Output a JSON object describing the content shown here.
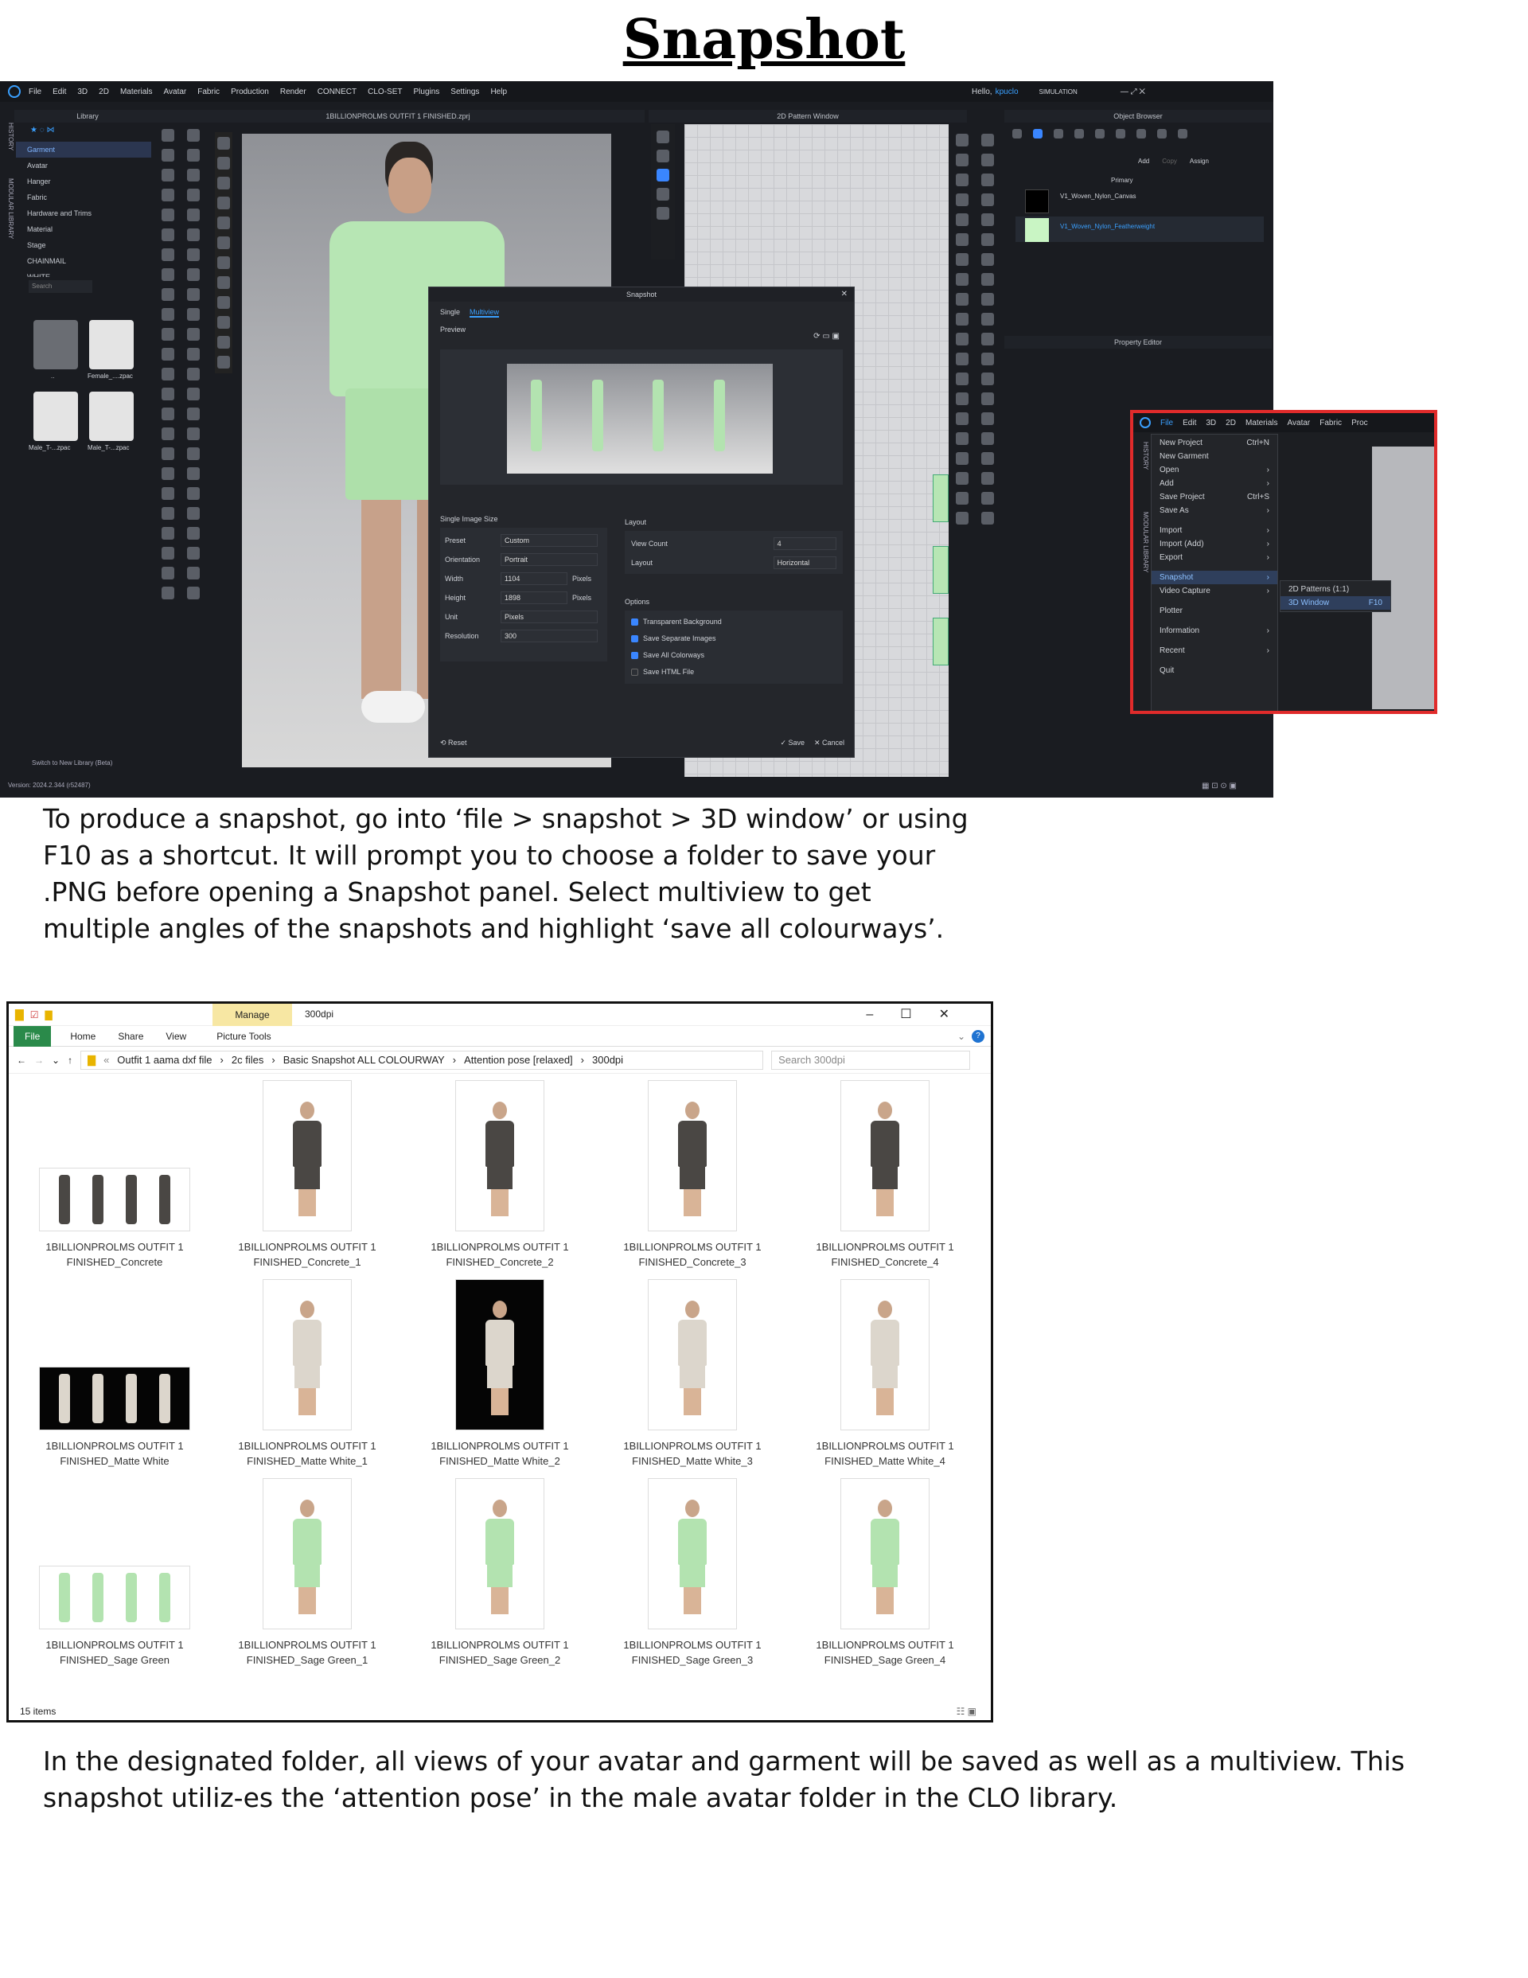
{
  "title": "Snapshot",
  "clo": {
    "menu": [
      "File",
      "Edit",
      "3D",
      "2D",
      "Materials",
      "Avatar",
      "Fabric",
      "Production",
      "Render",
      "CONNECT",
      "CLO-SET",
      "Plugins",
      "Settings",
      "Help"
    ],
    "greeting": "Hello,",
    "user": "kpuclo",
    "mode": "SIMULATION",
    "library_title": "Library",
    "window_title": "1BILLIONPROLMS OUTFIT 1 FINISHED.zprj",
    "pattern_title": "2D Pattern Window",
    "object_browser": "Object Browser",
    "property_editor": "Property Editor",
    "side_tabs": [
      "HISTORY",
      "MODULAR LIBRARY"
    ],
    "library_items": [
      "Garment",
      "Avatar",
      "Hanger",
      "Fabric",
      "Hardware and Trims",
      "Material",
      "Stage",
      "CHAINMAIL",
      "WHITE"
    ],
    "search": "Search",
    "thumbs": [
      "..",
      "Female_....zpac",
      "Male_T-...zpac",
      "Male_T-...zpac"
    ],
    "switch_lib": "Switch to New Library (Beta)",
    "version": "Version: 2024.2.344 (r52487)",
    "ob_actions": [
      "Add",
      "Copy",
      "Assign"
    ],
    "ob_primary": "Primary",
    "fabrics": [
      "V1_Woven_Nylon_Canvas",
      "V1_Woven_Nylon_Featherweight"
    ],
    "colors": {
      "canvas": "#000000",
      "featherweight": "#c9f5c4",
      "accent": "#3a86ff",
      "highlight": "#e02b2b",
      "garment": "#b7e6b4"
    }
  },
  "dialog": {
    "title": "Snapshot",
    "tabs": [
      "Single",
      "Multiview"
    ],
    "preview": "Preview",
    "image_size": "Single Image Size",
    "fields": [
      [
        "Preset",
        "Custom"
      ],
      [
        "Orientation",
        "Portrait"
      ],
      [
        "Width",
        "1104"
      ],
      [
        "Height",
        "1898"
      ],
      [
        "Unit",
        "Pixels"
      ],
      [
        "Resolution",
        "300"
      ]
    ],
    "px": "Pixels",
    "layout": "Layout",
    "layout_fields": [
      [
        "View Count",
        "4"
      ],
      [
        "Layout",
        "Horizontal"
      ]
    ],
    "options": "Options",
    "option_items": [
      "Transparent Background",
      "Save Separate Images",
      "Save All Colorways",
      "Save HTML File"
    ],
    "option_checked": [
      true,
      true,
      true,
      false
    ],
    "reset": "Reset",
    "save": "Save",
    "cancel": "Cancel"
  },
  "mini": {
    "menu": [
      "File",
      "Edit",
      "3D",
      "2D",
      "Materials",
      "Avatar",
      "Fabric",
      "Proc"
    ],
    "items": [
      [
        "New Project",
        "Ctrl+N"
      ],
      [
        "New Garment",
        ""
      ],
      [
        "Open",
        "›"
      ],
      [
        "Add",
        "›"
      ],
      [
        "Save Project",
        "Ctrl+S"
      ],
      [
        "Save As",
        "›"
      ],
      [
        "Import",
        "›"
      ],
      [
        "Import (Add)",
        "›"
      ],
      [
        "Export",
        "›"
      ],
      [
        "Snapshot",
        "›"
      ],
      [
        "Video Capture",
        "›"
      ],
      [
        "Plotter",
        ""
      ],
      [
        "Information",
        "›"
      ],
      [
        "Recent",
        "›"
      ],
      [
        "Quit",
        ""
      ]
    ],
    "sub": [
      [
        "2D Patterns (1:1)",
        ""
      ],
      [
        "3D Window",
        "F10"
      ]
    ],
    "side": [
      "HISTORY",
      "MODULAR LIBRARY"
    ]
  },
  "para1": "To produce a snapshot, go into ‘file > snapshot > 3D window’ or using F10 as a shortcut. It will prompt you to choose a folder to save your .PNG before opening a Snapshot panel. Select multiview to get multiple angles of the snapshots and highlight ‘save all colourways’.",
  "explorer": {
    "manage": "Manage",
    "folder": "300dpi",
    "ribbon": [
      "File",
      "Home",
      "Share",
      "View",
      "Picture Tools"
    ],
    "path": [
      "Outfit 1 aama dxf file",
      "2c files",
      "Basic Snapshot ALL COLOURWAY",
      "Attention pose [relaxed]",
      "300dpi"
    ],
    "search": "Search 300dpi",
    "rows": [
      {
        "color": "#4a4744",
        "names": [
          "1BILLIONPROLMS OUTFIT 1 FINISHED_Concrete",
          "1BILLIONPROLMS OUTFIT 1 FINISHED_Concrete_1",
          "1BILLIONPROLMS OUTFIT 1 FINISHED_Concrete_2",
          "1BILLIONPROLMS OUTFIT 1 FINISHED_Concrete_3",
          "1BILLIONPROLMS OUTFIT 1 FINISHED_Concrete_4"
        ]
      },
      {
        "color": "#dcd6cc",
        "names": [
          "1BILLIONPROLMS OUTFIT 1 FINISHED_Matte White",
          "1BILLIONPROLMS OUTFIT 1 FINISHED_Matte White_1",
          "1BILLIONPROLMS OUTFIT 1 FINISHED_Matte White_2",
          "1BILLIONPROLMS OUTFIT 1 FINISHED_Matte White_3",
          "1BILLIONPROLMS OUTFIT 1 FINISHED_Matte White_4"
        ]
      },
      {
        "color": "#b3e3b0",
        "names": [
          "1BILLIONPROLMS OUTFIT 1 FINISHED_Sage Green",
          "1BILLIONPROLMS OUTFIT 1 FINISHED_Sage Green_1",
          "1BILLIONPROLMS OUTFIT 1 FINISHED_Sage Green_2",
          "1BILLIONPROLMS OUTFIT 1 FINISHED_Sage Green_3",
          "1BILLIONPROLMS OUTFIT 1 FINISHED_Sage Green_4"
        ]
      }
    ],
    "status": "15 items"
  },
  "para2": "In the designated folder, all views of your avatar and garment will be saved as well as a multiview. This snapshot utiliz-es the ‘attention pose’ in the male avatar folder in the CLO library."
}
